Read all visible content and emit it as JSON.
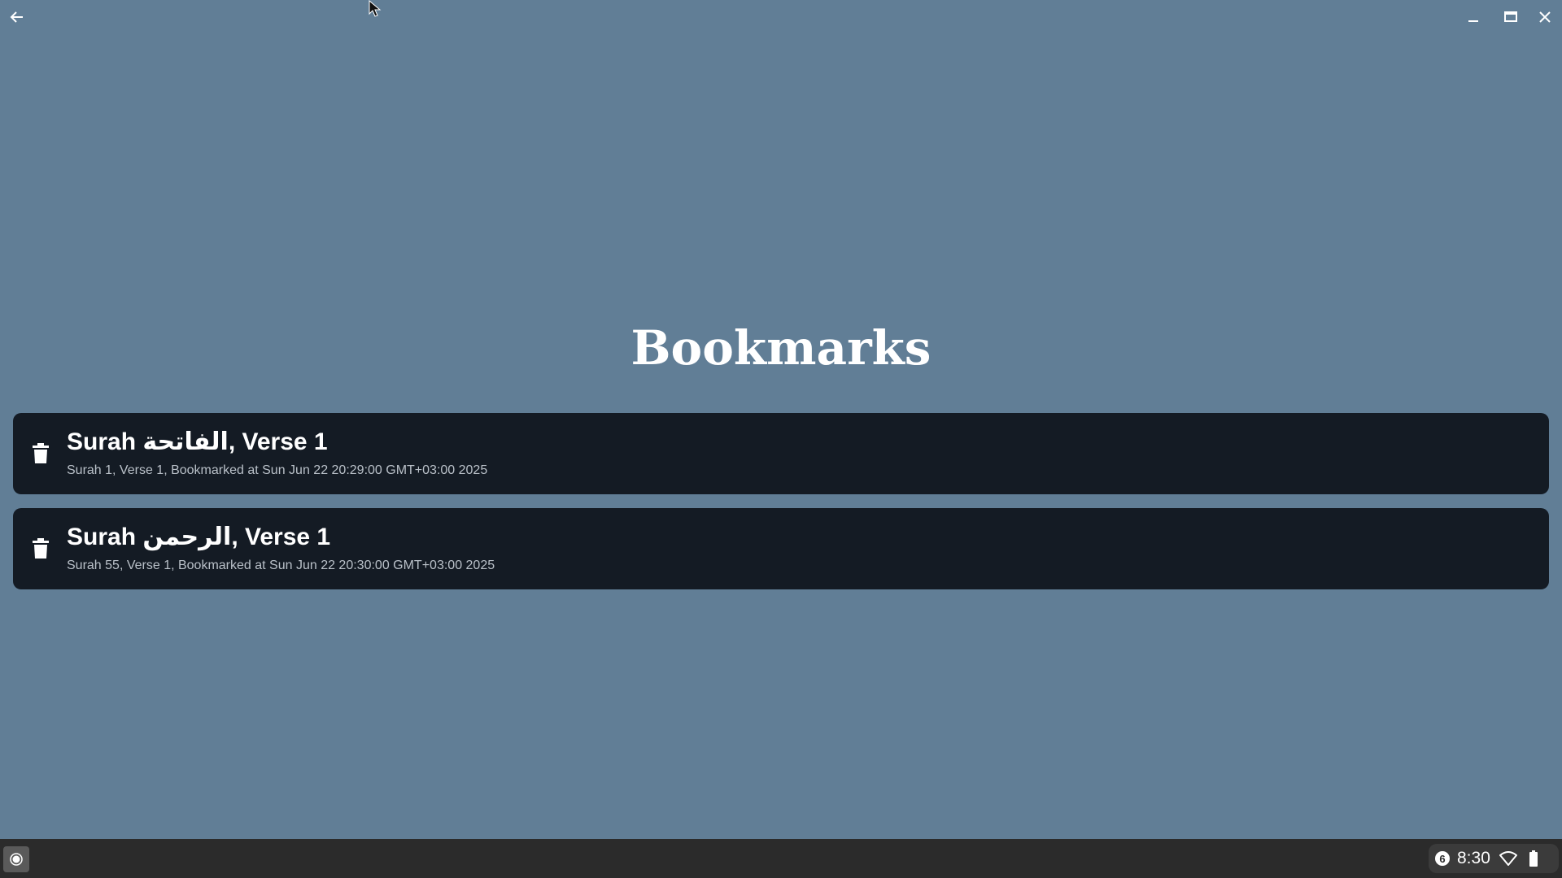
{
  "window": {
    "back_icon": "arrow-left-icon",
    "minimize_icon": "minimize-icon",
    "maximize_icon": "maximize-icon",
    "close_icon": "close-icon"
  },
  "page": {
    "title": "Bookmarks"
  },
  "bookmarks": [
    {
      "title": "Surah الفاتحة, Verse 1",
      "subtitle": "Surah 1, Verse 1, Bookmarked at Sun Jun 22 20:29:00 GMT+03:00 2025",
      "delete_icon": "trash-icon"
    },
    {
      "title": "Surah الرحمن, Verse 1",
      "subtitle": "Surah 55, Verse 1, Bookmarked at Sun Jun 22 20:30:00 GMT+03:00 2025",
      "delete_icon": "trash-icon"
    }
  ],
  "taskbar": {
    "launcher_icon": "launcher-icon",
    "notification_count": "6",
    "time": "8:30",
    "wifi_icon": "wifi-icon",
    "battery_icon": "battery-icon"
  },
  "colors": {
    "background": "#617e96",
    "card": "#141b24",
    "taskbar": "#2b2b2b"
  }
}
